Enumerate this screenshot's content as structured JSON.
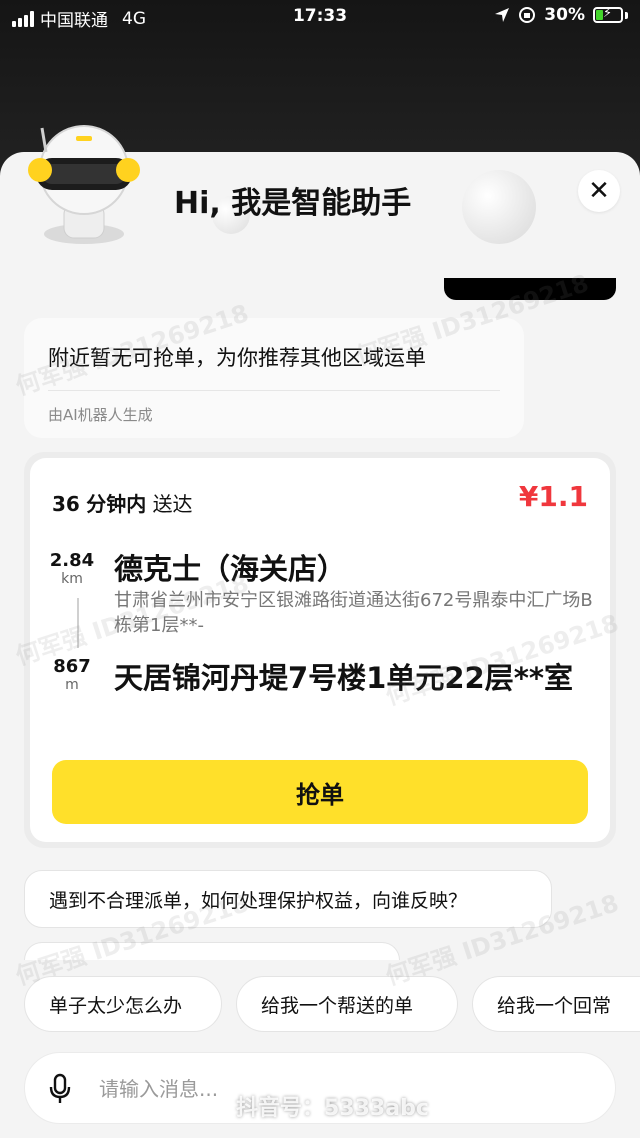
{
  "status_bar": {
    "carrier": "中国联通",
    "network": "4G",
    "time": "17:33",
    "battery": "30%",
    "battery_level": 0.3
  },
  "header": {
    "title": "Hi, 我是智能助手"
  },
  "ai_message": {
    "text": "附近暂无可抢单，为你推荐其他区域运单",
    "note": "由AI机器人生成"
  },
  "order": {
    "time_value": "36",
    "time_unit": "分钟内",
    "time_suffix": "送达",
    "price": "¥1.1",
    "pickup": {
      "distance": "2.84",
      "unit": "km",
      "name": "德克士（海关店）",
      "address": "甘肃省兰州市安宁区银滩路街道通达街672号鼎泰中汇广场B栋第1层**-"
    },
    "dropoff": {
      "distance": "867",
      "unit": "m",
      "name": "天居锦河丹堤7号楼1单元22层**室"
    },
    "grab_label": "抢单"
  },
  "suggestions": {
    "question": "遇到不合理派单，如何处理保护权益，向谁反映？",
    "chips": [
      "单子太少怎么办",
      "给我一个帮送的单",
      "给我一个回常"
    ]
  },
  "input": {
    "placeholder": "请输入消息..."
  },
  "watermark": {
    "text": "何军强 ID31269218",
    "douyin": "抖音号：5333abc"
  },
  "colors": {
    "accent_yellow": "#ffe02a",
    "price_red": "#f0373d"
  }
}
